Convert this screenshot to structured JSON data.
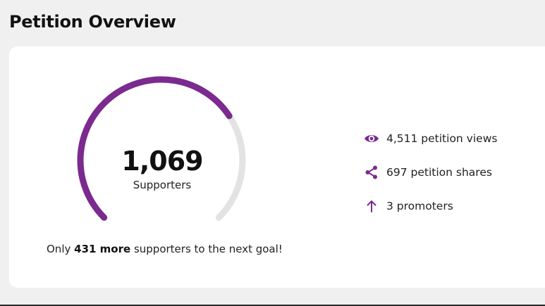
{
  "page": {
    "title": "Petition Overview"
  },
  "overview": {
    "supporters_count": "1,069",
    "supporters_label": "Supporters",
    "progress_fraction": 0.71,
    "goal_prefix": "Only ",
    "goal_highlight": "431 more",
    "goal_suffix": " supporters to the next goal!",
    "stats": {
      "views": "4,511 petition views",
      "shares": "697 petition shares",
      "promoters": "3 promoters"
    }
  },
  "colors": {
    "accent": "#7b2a8f",
    "track": "#e3e3e3",
    "background": "#f0f0f0",
    "card": "#ffffff"
  },
  "icons": {
    "views": "eye-icon",
    "shares": "share-icon",
    "promoters": "arrow-up-icon"
  }
}
